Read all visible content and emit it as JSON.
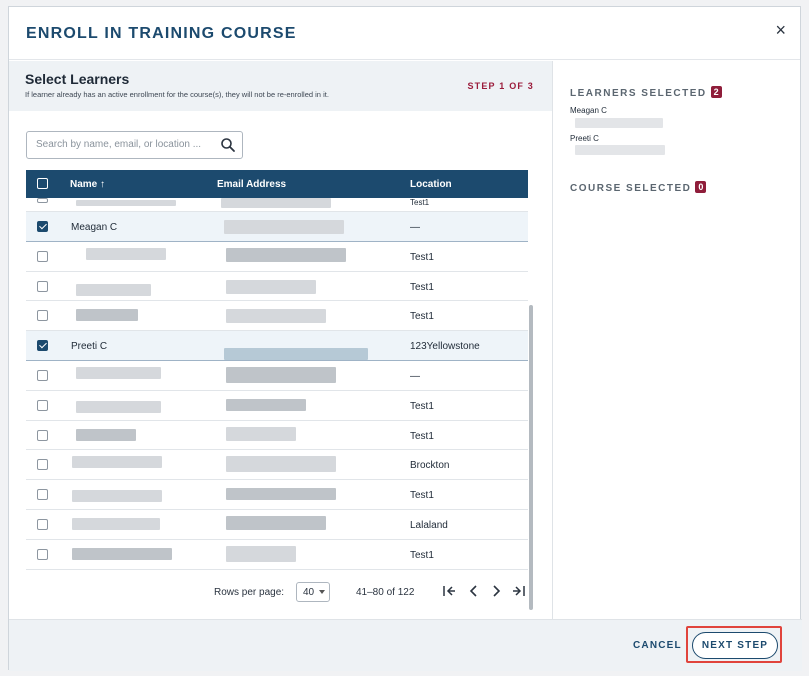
{
  "modal": {
    "title": "ENROLL IN TRAINING COURSE",
    "close_label": "×"
  },
  "select_learners": {
    "title": "Select Learners",
    "subtitle": "If learner already has an active enrollment for the course(s), they will not be re-enrolled in it.",
    "step": "STEP 1 OF 3"
  },
  "search": {
    "placeholder": "Search by name, email, or location ...",
    "value": ""
  },
  "table": {
    "columns": [
      "Name ↑",
      "Email Address",
      "Location"
    ],
    "rows": [
      {
        "name": "",
        "location": "Test1",
        "checked": false
      },
      {
        "name": "Meagan C",
        "location": "—",
        "checked": true
      },
      {
        "name": "",
        "location": "Test1",
        "checked": false
      },
      {
        "name": "",
        "location": "Test1",
        "checked": false
      },
      {
        "name": "",
        "location": "Test1",
        "checked": false
      },
      {
        "name": "Preeti C",
        "location": "123Yellowstone",
        "checked": true
      },
      {
        "name": "",
        "location": "—",
        "checked": false
      },
      {
        "name": "",
        "location": "Test1",
        "checked": false
      },
      {
        "name": "",
        "location": "Test1",
        "checked": false
      },
      {
        "name": "",
        "location": "Brockton",
        "checked": false
      },
      {
        "name": "",
        "location": "Test1",
        "checked": false
      },
      {
        "name": "",
        "location": "Lalaland",
        "checked": false
      },
      {
        "name": "",
        "location": "Test1",
        "checked": false
      }
    ]
  },
  "pagination": {
    "rows_per_page_label": "Rows per page:",
    "rows_per_page": "40",
    "range": "41–80 of 122"
  },
  "summary": {
    "learners_label": "LEARNERS SELECTED",
    "learners_count": "2",
    "learners": [
      "Meagan C",
      "Preeti C"
    ],
    "course_label": "COURSE SELECTED",
    "course_count": "0"
  },
  "footer": {
    "cancel_label": "CANCEL",
    "next_label": "NEXT STEP"
  },
  "colors": {
    "primary": "#1c4a6e",
    "accent": "#8f1d3a",
    "highlight": "#e0443c"
  }
}
